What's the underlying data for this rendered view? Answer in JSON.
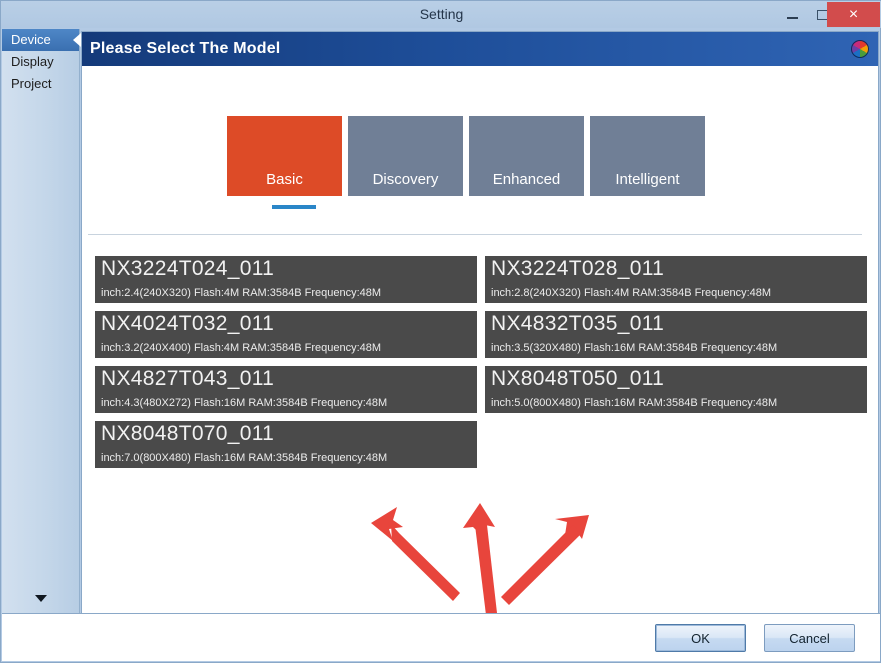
{
  "window": {
    "title": "Setting",
    "controls": {
      "minimize": "minimize",
      "maximize": "maximize",
      "close": "×"
    }
  },
  "sidebar": {
    "items": [
      {
        "label": "Device",
        "selected": true
      },
      {
        "label": "Display",
        "selected": false
      },
      {
        "label": "Project",
        "selected": false
      }
    ],
    "scroll_down_label": "scroll down"
  },
  "panel": {
    "header_title": "Please Select The Model",
    "brand_logo": "nextion-logo-icon"
  },
  "tabs": [
    {
      "label": "Basic",
      "active": true
    },
    {
      "label": "Discovery",
      "active": false
    },
    {
      "label": "Enhanced",
      "active": false
    },
    {
      "label": "Intelligent",
      "active": false
    }
  ],
  "models": [
    {
      "name": "NX3224T024_011",
      "spec": "inch:2.4(240X320) Flash:4M RAM:3584B Frequency:48M"
    },
    {
      "name": "NX3224T028_011",
      "spec": "inch:2.8(240X320) Flash:4M RAM:3584B Frequency:48M"
    },
    {
      "name": "NX4024T032_011",
      "spec": "inch:3.2(240X400) Flash:4M RAM:3584B Frequency:48M"
    },
    {
      "name": "NX4832T035_011",
      "spec": "inch:3.5(320X480) Flash:16M RAM:3584B Frequency:48M"
    },
    {
      "name": "NX4827T043_011",
      "spec": "inch:4.3(480X272) Flash:16M RAM:3584B Frequency:48M"
    },
    {
      "name": "NX8048T050_011",
      "spec": "inch:5.0(800X480) Flash:16M RAM:3584B Frequency:48M"
    },
    {
      "name": "NX8048T070_011",
      "spec": "inch:7.0(800X480) Flash:16M RAM:3584B Frequency:48M"
    }
  ],
  "annotation": {
    "arrow_color": "#e8453c",
    "arrows": [
      {
        "name": "arrow-up-left",
        "direction": "up-left"
      },
      {
        "name": "arrow-up",
        "direction": "up"
      },
      {
        "name": "arrow-up-right",
        "direction": "up-right"
      }
    ]
  },
  "footer": {
    "ok_label": "OK",
    "cancel_label": "Cancel"
  },
  "colors": {
    "accent_orange": "#dd4b27",
    "tab_inactive": "#707f96",
    "header_blue": "#1e4e99",
    "card_gray": "#4a4a4a",
    "underline_blue": "#2a86c8",
    "close_red": "#d24c4c"
  }
}
